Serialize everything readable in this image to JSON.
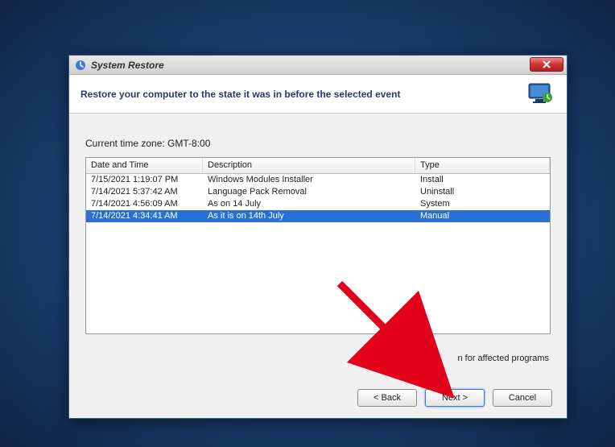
{
  "window": {
    "title": "System Restore"
  },
  "header": {
    "text": "Restore your computer to the state it was in before the selected event"
  },
  "timezone_label": "Current time zone: GMT-8:00",
  "table": {
    "columns": {
      "datetime": "Date and Time",
      "description": "Description",
      "type": "Type"
    },
    "rows": [
      {
        "datetime": "7/15/2021 1:19:07 PM",
        "description": "Windows Modules Installer",
        "type": "Install",
        "selected": false
      },
      {
        "datetime": "7/14/2021 5:37:42 AM",
        "description": "Language Pack Removal",
        "type": "Uninstall",
        "selected": false
      },
      {
        "datetime": "7/14/2021 4:56:09 AM",
        "description": "As on 14 July",
        "type": "System",
        "selected": false
      },
      {
        "datetime": "7/14/2021 4:34:41 AM",
        "description": "As it is on 14th July",
        "type": "Manual",
        "selected": true
      }
    ]
  },
  "scan_link": "n for affected programs",
  "buttons": {
    "back": "< Back",
    "next": "Next >",
    "cancel": "Cancel"
  }
}
